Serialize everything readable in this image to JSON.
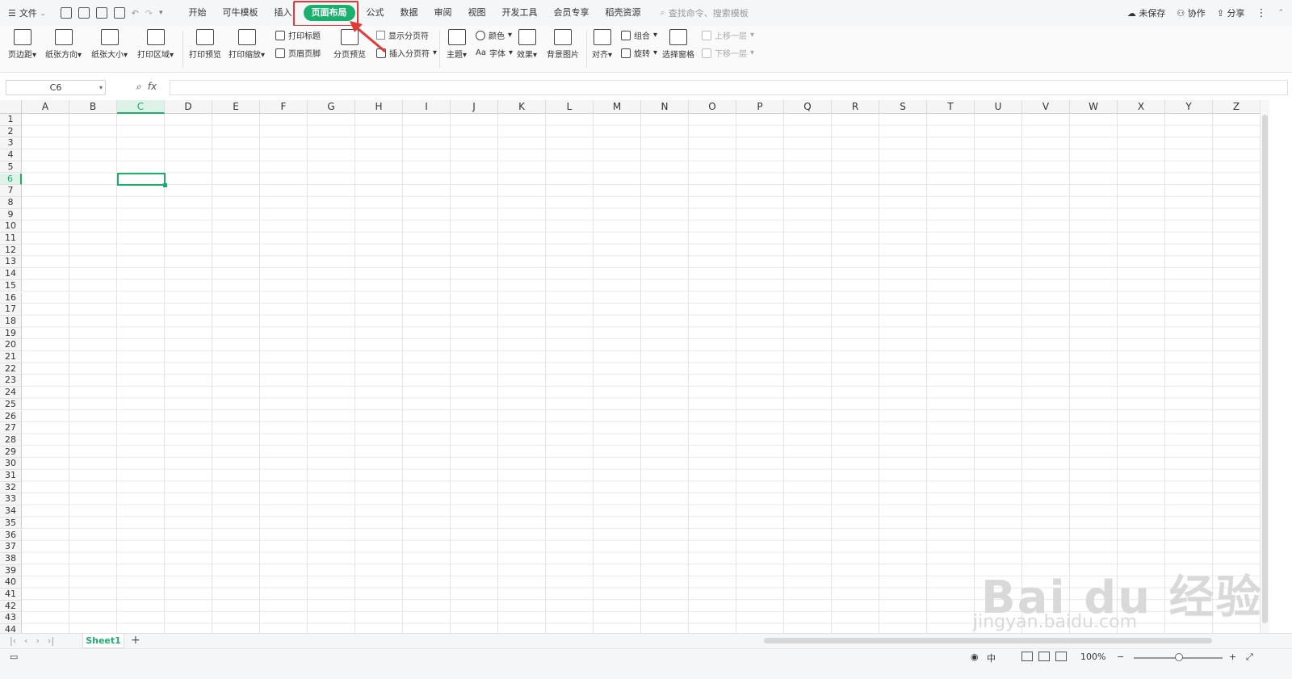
{
  "menubar": {
    "file_label": "文件",
    "tabs": [
      "开始",
      "可牛模板",
      "插入",
      "页面布局",
      "公式",
      "数据",
      "审阅",
      "视图",
      "开发工具",
      "会员专享",
      "稻壳资源"
    ],
    "active_tab": "页面布局",
    "search_placeholder": "查找命令、搜索模板",
    "unsaved": "未保存",
    "collab": "协作",
    "share": "分享"
  },
  "ribbon": {
    "margins": "页边距",
    "orientation": "纸张方向",
    "size": "纸张大小",
    "print_area": "打印区域",
    "print_preview": "打印预览",
    "print_scale": "打印缩放",
    "print_titles": "打印标题",
    "header_footer": "页眉页脚",
    "page_break_preview": "分页预览",
    "show_page_breaks": "显示分页符",
    "insert_page_break": "插入分页符",
    "theme": "主题",
    "colors": "颜色",
    "fonts": "字体",
    "effects": "效果",
    "background": "背景图片",
    "align": "对齐",
    "group": "组合",
    "rotate": "旋转",
    "selection_pane": "选择窗格",
    "bring_forward": "上移一层",
    "send_backward": "下移一层"
  },
  "formula_bar": {
    "cell_ref": "C6",
    "fx": "fx",
    "value": ""
  },
  "grid": {
    "columns": [
      "A",
      "B",
      "C",
      "D",
      "E",
      "F",
      "G",
      "H",
      "I",
      "J",
      "K",
      "L",
      "M",
      "N",
      "O",
      "P",
      "Q",
      "R",
      "S",
      "T",
      "U",
      "V",
      "W",
      "X",
      "Y",
      "Z"
    ],
    "rows": [
      "1",
      "2",
      "3",
      "4",
      "5",
      "6",
      "7",
      "8",
      "9",
      "10",
      "11",
      "12",
      "13",
      "14",
      "15",
      "16",
      "17",
      "18",
      "19",
      "20",
      "21",
      "22",
      "23",
      "24",
      "25",
      "26",
      "27",
      "28",
      "29",
      "30",
      "31",
      "32",
      "33",
      "34",
      "35",
      "36",
      "37",
      "38",
      "39",
      "40",
      "41",
      "42",
      "43",
      "44"
    ],
    "selected_column": "C",
    "selected_row": "6"
  },
  "sheets": {
    "tabs": [
      "Sheet1"
    ],
    "add_label": "+"
  },
  "status": {
    "zoom": "100%",
    "input_mode": "中",
    "zoom_minus": "−",
    "zoom_plus": "+"
  },
  "watermark": {
    "brand": "Bai du 经验",
    "url": "jingyan.baidu.com"
  },
  "colors": {
    "accent": "#1aaf6c",
    "highlight_box": "#e53935"
  }
}
